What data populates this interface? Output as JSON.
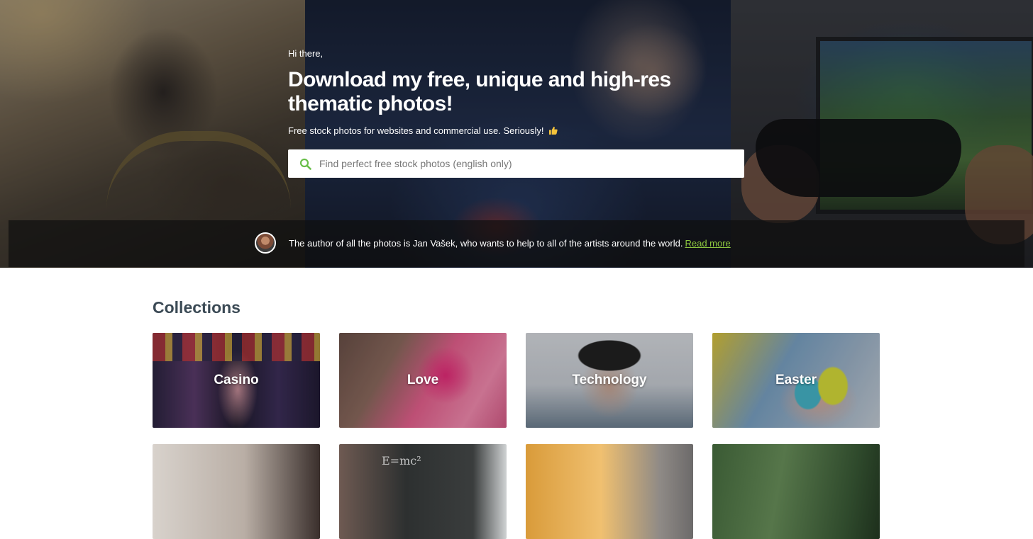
{
  "hero": {
    "greeting": "Hi there,",
    "headline": "Download my free, unique and high-res thematic photos!",
    "subline": "Free stock photos for websites and commercial use. Seriously!",
    "subline_icon": "thumbs-up-icon",
    "search": {
      "icon": "search-icon",
      "placeholder": "Find perfect free stock photos (english only)",
      "value": ""
    },
    "author_bar": {
      "text": "The author of all the photos is Jan Vašek, who wants to help to all of the artists around the world.",
      "link_label": "Read more"
    }
  },
  "collections": {
    "title": "Collections",
    "items": [
      {
        "label": "Casino"
      },
      {
        "label": "Love"
      },
      {
        "label": "Technology"
      },
      {
        "label": "Easter"
      },
      {
        "label": ""
      },
      {
        "label": ""
      },
      {
        "label": ""
      },
      {
        "label": ""
      }
    ],
    "decor": {
      "chalk_text": "E=mc²"
    }
  },
  "colors": {
    "accent": "#8cc63f",
    "search_icon": "#6abf4b",
    "heading": "#3b4a55",
    "author_bar_bg": "rgba(15,15,15,0.72)"
  }
}
